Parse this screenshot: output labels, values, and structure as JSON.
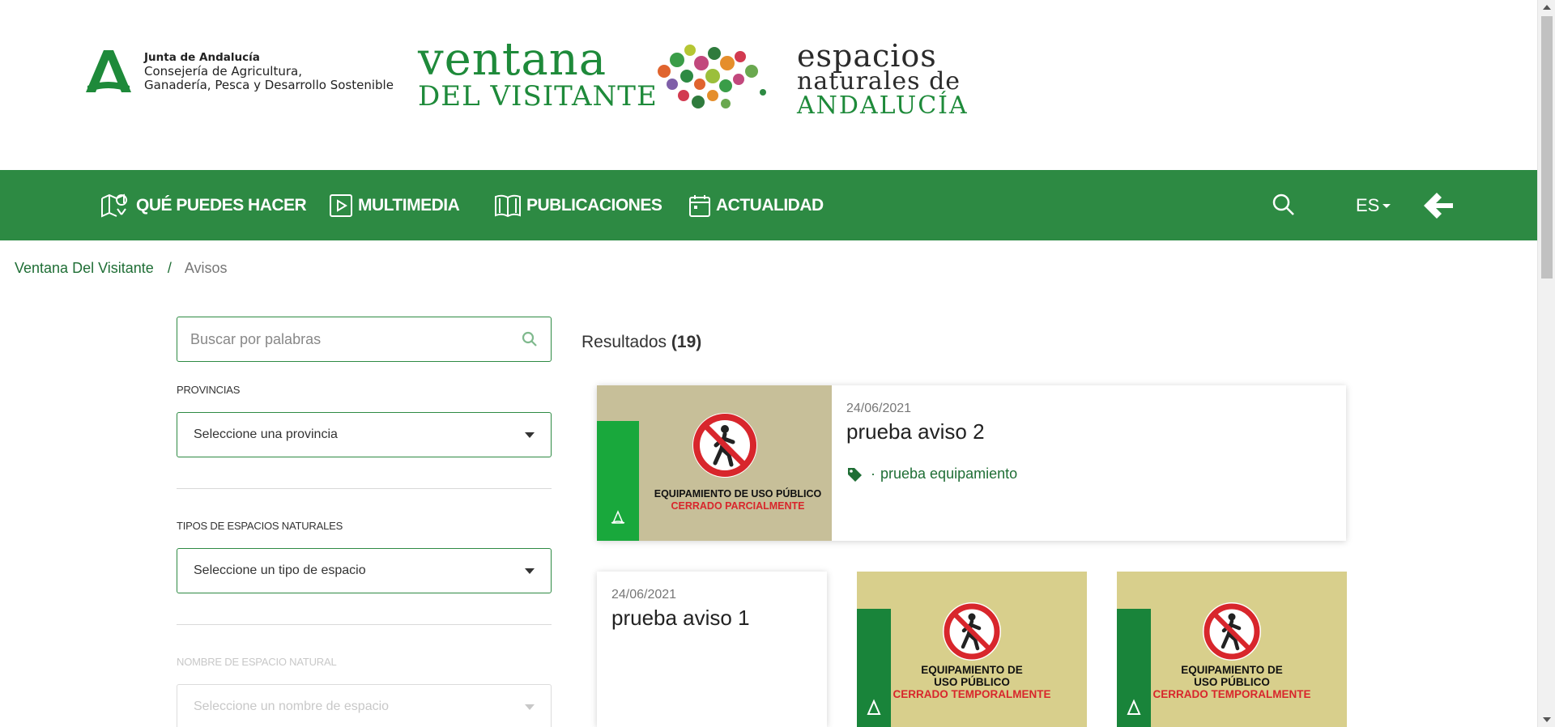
{
  "header": {
    "junta": {
      "line1": "Junta de Andalucía",
      "line2": "Consejería de Agricultura,",
      "line3": "Ganadería, Pesca y Desarrollo Sostenible"
    },
    "ventana": {
      "line1": "ventana",
      "line2": "DEL VISITANTE"
    },
    "espacios": {
      "line1": "espacios",
      "line2": "naturales de",
      "line3": "ANDALUCÍA"
    }
  },
  "nav": {
    "items": [
      {
        "label": "QUÉ PUEDES HACER",
        "icon": "map-pin-icon"
      },
      {
        "label": "MULTIMEDIA",
        "icon": "play-icon"
      },
      {
        "label": "PUBLICACIONES",
        "icon": "book-icon"
      },
      {
        "label": "ACTUALIDAD",
        "icon": "calendar-icon"
      }
    ],
    "language": "ES",
    "colors": {
      "bar": "#2d8a43",
      "accent": "#1f6e35"
    }
  },
  "breadcrumb": {
    "home": "Ventana Del Visitante",
    "separator": "/",
    "current": "Avisos"
  },
  "sidebar": {
    "search_placeholder": "Buscar por palabras",
    "provincias_label": "PROVINCIAS",
    "provincias_value": "Seleccione una provincia",
    "tipos_label": "TIPOS DE ESPACIOS NATURALES",
    "tipos_value": "Seleccione un tipo de espacio",
    "nombre_label": "NOMBRE DE ESPACIO NATURAL",
    "nombre_value": "Seleccione un nombre de espacio"
  },
  "results": {
    "label": "Resultados",
    "count": "(19)",
    "cards": [
      {
        "date": "24/06/2021",
        "title": "prueba aviso 2",
        "tag_bullet": "·",
        "tag": "prueba equipamiento",
        "image_text1": "EQUIPAMIENTO DE USO PÚBLICO",
        "image_text2": "CERRADO PARCIALMENTE"
      },
      {
        "date": "24/06/2021",
        "title": "prueba aviso 1"
      },
      {
        "image_text1": "EQUIPAMIENTO DE",
        "image_text2": "USO PÚBLICO",
        "image_text3": "CERRADO TEMPORALMENTE"
      },
      {
        "image_text1": "EQUIPAMIENTO DE",
        "image_text2": "USO PÚBLICO",
        "image_text3": "CERRADO TEMPORALMENTE"
      }
    ]
  }
}
